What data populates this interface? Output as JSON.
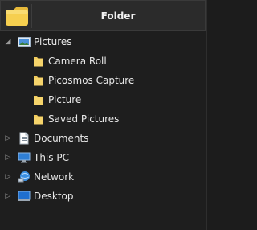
{
  "header": {
    "title": "Folder",
    "icon": "folder-icon"
  },
  "tree": {
    "pictures": {
      "label": "Pictures",
      "expanded": true,
      "icon": "pictures-library-icon",
      "children": [
        {
          "label": "Camera Roll",
          "icon": "folder-icon"
        },
        {
          "label": "Picosmos Capture",
          "icon": "folder-icon"
        },
        {
          "label": "Picture",
          "icon": "folder-icon"
        },
        {
          "label": "Saved Pictures",
          "icon": "folder-icon"
        }
      ]
    },
    "documents": {
      "label": "Documents",
      "icon": "documents-icon"
    },
    "this_pc": {
      "label": "This PC",
      "icon": "computer-icon"
    },
    "network": {
      "label": "Network",
      "icon": "network-icon"
    },
    "desktop": {
      "label": "Desktop",
      "icon": "desktop-icon"
    }
  },
  "colors": {
    "background": "#1e1e1e",
    "header_bg": "#2b2b2b",
    "folder_yellow": "#f5d469",
    "text": "#e8e8e8"
  }
}
